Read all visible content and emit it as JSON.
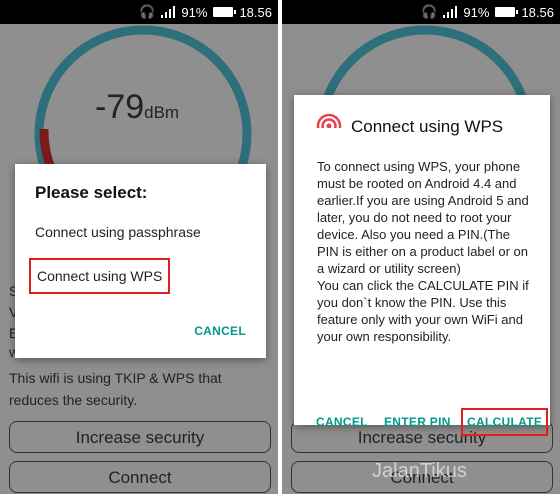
{
  "status": {
    "battery": "91%",
    "time": "18.56"
  },
  "gauge": {
    "value": "-79",
    "unit": "dBm",
    "partial": "20"
  },
  "info": {
    "left_letters": [
      "S",
      "V",
      "E",
      "WPS"
    ],
    "line1": "This wifi is using TKIP & WPS that",
    "line2": "reduces the security."
  },
  "buttons": {
    "increase": "Increase security",
    "connect": "Connect"
  },
  "select_dialog": {
    "title": "Please select:",
    "option1": "Connect using passphrase",
    "option2": "Connect using WPS",
    "cancel": "CANCEL"
  },
  "wps_dialog": {
    "title": "Connect using WPS",
    "body": "To connect using WPS, your phone must be rooted on Android 4.4 and earlier.If you are using Android 5 and later, you do not need to root your device. Also you need a PIN.(The PIN is either on a product label or on a wizard or utility screen)\nYou can click the CALCULATE PIN if you don`t know the PIN. Use this feature only with your own WiFi and your own responsibility.",
    "cancel": "CANCEL",
    "enter_pin": "ENTER PIN",
    "calculate": "CALCULATE"
  },
  "watermark": "JalanTikus",
  "colors": {
    "accent": "#009a8a",
    "highlight": "#e02020",
    "gauge_blue": "#2d7d8c",
    "gauge_red": "#8b1d1d",
    "wps_icon": "#e8424f"
  }
}
